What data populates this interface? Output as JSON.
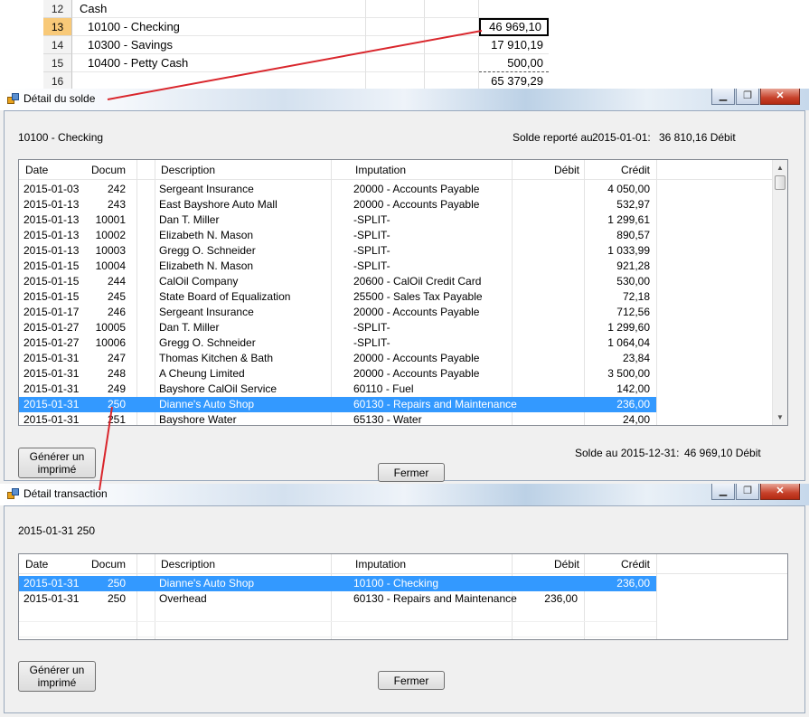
{
  "spreadsheet": {
    "rows": [
      {
        "num": "12",
        "label": "Cash",
        "value": ""
      },
      {
        "num": "13",
        "label": "10100 - Checking",
        "value": "46 969,10"
      },
      {
        "num": "14",
        "label": "10300 - Savings",
        "value": "17 910,19"
      },
      {
        "num": "15",
        "label": "10400 - Petty Cash",
        "value": "500,00"
      },
      {
        "num": "16",
        "label": "",
        "value": "65 379,29"
      }
    ]
  },
  "window1": {
    "title": "Détail du solde",
    "account": "10100 - Checking",
    "reported_label": "Solde reporté au",
    "reported_date": "2015-01-01:",
    "reported_value": "36 810,16 Débit",
    "columns": {
      "date": "Date",
      "doc": "Docum",
      "desc": "Description",
      "imput": "Imputation",
      "debit": "Débit",
      "credit": "Crédit"
    },
    "rows": [
      {
        "date": "2015-01-03",
        "doc": "242",
        "desc": "Sergeant Insurance",
        "imput": "20000 - Accounts Payable",
        "debit": "",
        "credit": "4 050,00"
      },
      {
        "date": "2015-01-13",
        "doc": "243",
        "desc": "East Bayshore Auto Mall",
        "imput": "20000 - Accounts Payable",
        "debit": "",
        "credit": "532,97"
      },
      {
        "date": "2015-01-13",
        "doc": "10001",
        "desc": "Dan T. Miller",
        "imput": "-SPLIT-",
        "debit": "",
        "credit": "1 299,61"
      },
      {
        "date": "2015-01-13",
        "doc": "10002",
        "desc": "Elizabeth N. Mason",
        "imput": "-SPLIT-",
        "debit": "",
        "credit": "890,57"
      },
      {
        "date": "2015-01-13",
        "doc": "10003",
        "desc": "Gregg O. Schneider",
        "imput": "-SPLIT-",
        "debit": "",
        "credit": "1 033,99"
      },
      {
        "date": "2015-01-15",
        "doc": "10004",
        "desc": "Elizabeth N. Mason",
        "imput": "-SPLIT-",
        "debit": "",
        "credit": "921,28"
      },
      {
        "date": "2015-01-15",
        "doc": "244",
        "desc": "CalOil Company",
        "imput": "20600 - CalOil Credit Card",
        "debit": "",
        "credit": "530,00"
      },
      {
        "date": "2015-01-15",
        "doc": "245",
        "desc": "State Board of Equalization",
        "imput": "25500 - Sales Tax Payable",
        "debit": "",
        "credit": "72,18"
      },
      {
        "date": "2015-01-17",
        "doc": "246",
        "desc": "Sergeant Insurance",
        "imput": "20000 - Accounts Payable",
        "debit": "",
        "credit": "712,56"
      },
      {
        "date": "2015-01-27",
        "doc": "10005",
        "desc": "Dan T. Miller",
        "imput": "-SPLIT-",
        "debit": "",
        "credit": "1 299,60"
      },
      {
        "date": "2015-01-27",
        "doc": "10006",
        "desc": "Gregg O. Schneider",
        "imput": "-SPLIT-",
        "debit": "",
        "credit": "1 064,04"
      },
      {
        "date": "2015-01-31",
        "doc": "247",
        "desc": "Thomas Kitchen & Bath",
        "imput": "20000 - Accounts Payable",
        "debit": "",
        "credit": "23,84"
      },
      {
        "date": "2015-01-31",
        "doc": "248",
        "desc": "A Cheung Limited",
        "imput": "20000 - Accounts Payable",
        "debit": "",
        "credit": "3 500,00"
      },
      {
        "date": "2015-01-31",
        "doc": "249",
        "desc": "Bayshore CalOil Service",
        "imput": "60110 - Fuel",
        "debit": "",
        "credit": "142,00"
      },
      {
        "date": "2015-01-31",
        "doc": "250",
        "desc": "Dianne's Auto Shop",
        "imput": "60130 - Repairs and Maintenance",
        "debit": "",
        "credit": "236,00"
      },
      {
        "date": "2015-01-31",
        "doc": "251",
        "desc": "Bayshore Water",
        "imput": "65130 - Water",
        "debit": "",
        "credit": "24,00"
      }
    ],
    "selected_row": 14,
    "print_button": "Générer un imprimé",
    "close_button": "Fermer",
    "balance_label": "Solde au 2015-12-31:",
    "balance_value": "46 969,10 Débit"
  },
  "window2": {
    "title": "Détail transaction",
    "header_date": "2015-01-31",
    "header_doc": "250",
    "columns": {
      "date": "Date",
      "doc": "Docum",
      "desc": "Description",
      "imput": "Imputation",
      "debit": "Débit",
      "credit": "Crédit"
    },
    "rows": [
      {
        "date": "2015-01-31",
        "doc": "250",
        "desc": "Dianne's Auto Shop",
        "imput": "10100 - Checking",
        "debit": "",
        "credit": "236,00"
      },
      {
        "date": "2015-01-31",
        "doc": "250",
        "desc": "Overhead",
        "imput": "60130 - Repairs and Maintenance",
        "debit": "236,00",
        "credit": ""
      }
    ],
    "selected_row": 0,
    "print_button": "Générer un imprimé",
    "close_button": "Fermer"
  },
  "colors": {
    "selection": "#3399ff",
    "annotation": "#d9262c"
  }
}
